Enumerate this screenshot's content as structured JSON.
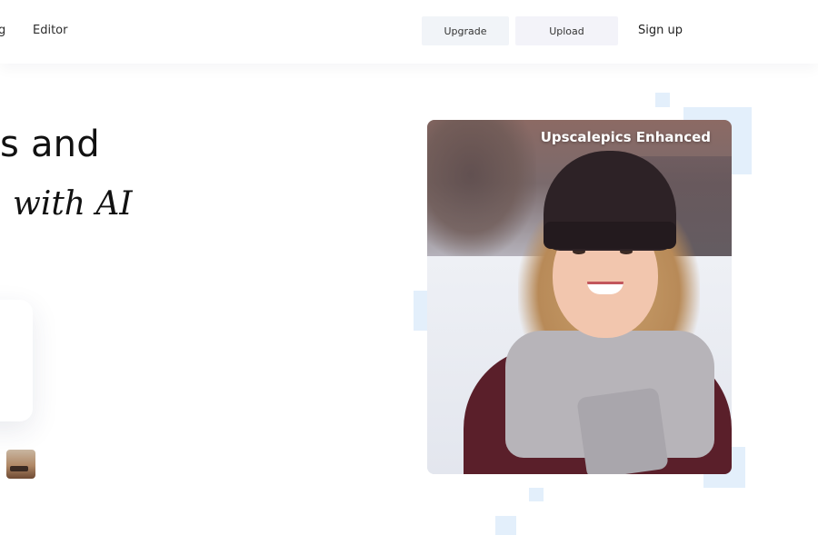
{
  "header": {
    "nav_cut_label": "g",
    "nav_editor_label": "Editor",
    "upgrade_label": "Upgrade",
    "upload_label": "Upload",
    "signup_label": "Sign up"
  },
  "hero": {
    "headline_line1": "s and",
    "headline_line2": "with AI"
  },
  "photo": {
    "label": "Upscalepics Enhanced"
  },
  "colors": {
    "accent_square": "#e3effb",
    "upgrade_bg": "#f1f4f8",
    "upload_bg": "#f3f3f9"
  }
}
